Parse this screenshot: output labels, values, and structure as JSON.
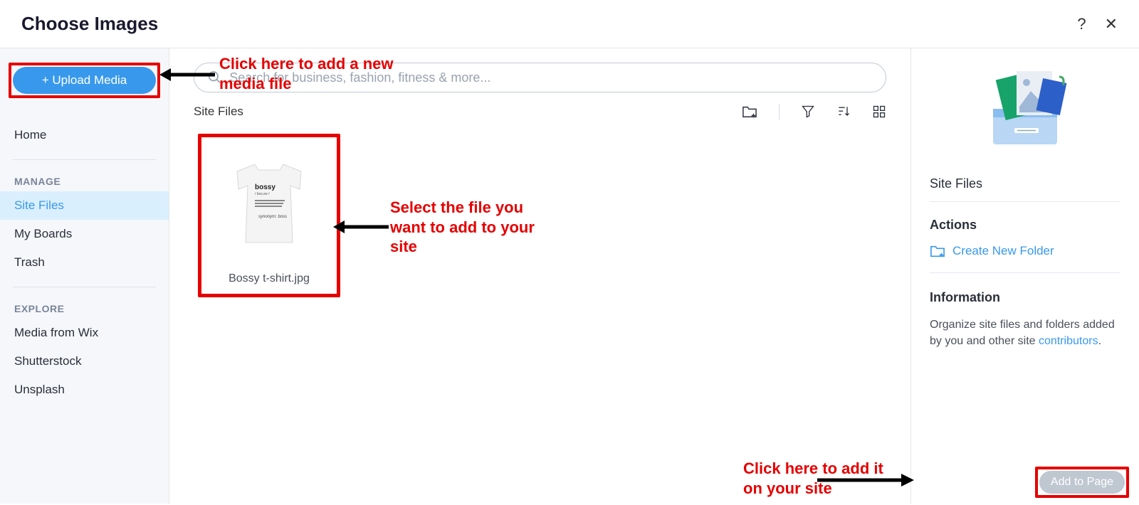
{
  "header": {
    "title": "Choose Images",
    "help_icon": "?",
    "close_icon": "✕"
  },
  "sidebar": {
    "upload_label": "+ Upload Media",
    "home_label": "Home",
    "manage_label": "MANAGE",
    "site_files_label": "Site Files",
    "my_boards_label": "My Boards",
    "trash_label": "Trash",
    "explore_label": "EXPLORE",
    "media_wix_label": "Media from Wix",
    "shutterstock_label": "Shutterstock",
    "unsplash_label": "Unsplash"
  },
  "main": {
    "search_placeholder": "Search for business, fashion, fitness & more...",
    "breadcrumb": "Site Files",
    "file": {
      "name": "Bossy t-shirt.jpg"
    }
  },
  "right": {
    "title": "Site Files",
    "actions_label": "Actions",
    "create_folder_label": "Create New Folder",
    "info_label": "Information",
    "info_text_prefix": "Organize site files and folders added by you and other site ",
    "info_link": "contributors",
    "add_to_page_label": "Add to Page"
  },
  "annotations": {
    "a1": "Click here to add a new media file",
    "a2": "Select the file you want to add to your site",
    "a3": "Click here to add it on your site"
  }
}
